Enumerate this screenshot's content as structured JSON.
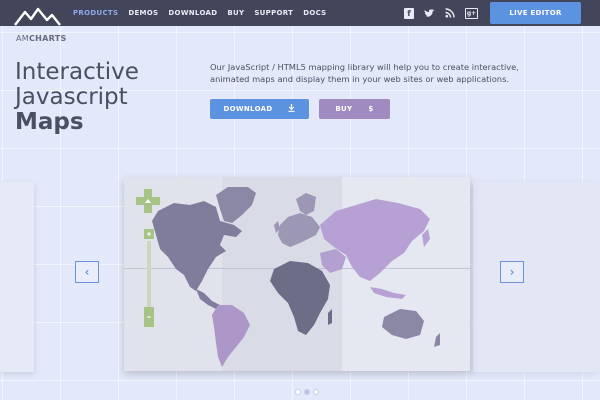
{
  "brand": {
    "logo_text_light": "AM",
    "logo_text_bold": "CHARTS"
  },
  "nav": {
    "items": [
      {
        "label": "PRODUCTS",
        "active": true
      },
      {
        "label": "DEMOS",
        "active": false
      },
      {
        "label": "DOWNLOAD",
        "active": false
      },
      {
        "label": "BUY",
        "active": false
      },
      {
        "label": "SUPPORT",
        "active": false
      },
      {
        "label": "DOCS",
        "active": false
      }
    ],
    "social": {
      "facebook": "f",
      "twitter": "t",
      "rss": "rss",
      "gplus": "g+"
    },
    "live_editor": "LIVE EDITOR"
  },
  "hero": {
    "title_line1": "Interactive",
    "title_line2": "Javascript",
    "title_line3": "Maps",
    "description": "Our JavaScript / HTML5 mapping library will help you to create interactive, animated maps and display them in your web sites or web applications.",
    "download_label": "DOWNLOAD",
    "download_icon": "download-icon",
    "buy_label": "BUY",
    "buy_icon": "$"
  },
  "carousel": {
    "prev_icon": "‹",
    "next_icon": "›",
    "dots": [
      {
        "active": false
      },
      {
        "active": true
      },
      {
        "active": false
      }
    ]
  },
  "colors": {
    "nav_bg": "#43465a",
    "accent_blue": "#5b93e0",
    "accent_purple": "#a08bc0",
    "page_bg": "#e3e8fa",
    "map_dark": "#6e6d88",
    "map_light": "#b7a0d3",
    "map_mid": "#9b97b4",
    "zoom_green": "#a7c487"
  }
}
